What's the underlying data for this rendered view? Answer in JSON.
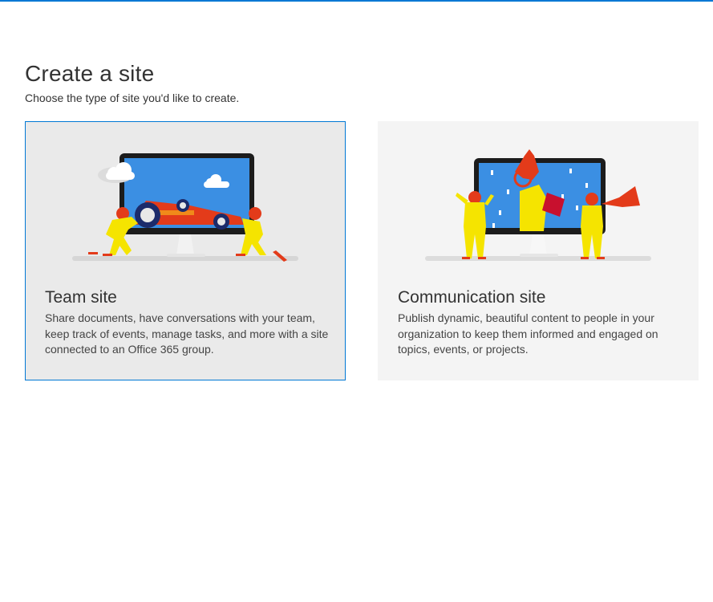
{
  "page": {
    "title": "Create a site",
    "subtitle": "Choose the type of site you'd like to create."
  },
  "cards": [
    {
      "title": "Team site",
      "description": "Share documents, have conversations with your team, keep track of events, manage tasks, and more with a site connected to an Office 365 group.",
      "selected": true
    },
    {
      "title": "Communication site",
      "description": "Publish dynamic, beautiful content to people in your organization to keep them informed and engaged on topics, events, or projects.",
      "selected": false
    }
  ],
  "colors": {
    "accent": "#0078d4",
    "selected_card_bg": "#eaeaea",
    "card_bg": "#f4f4f4",
    "screen_blue": "#3b8fe3",
    "figure_yellow": "#f5e400",
    "figure_red": "#e33b1a"
  }
}
